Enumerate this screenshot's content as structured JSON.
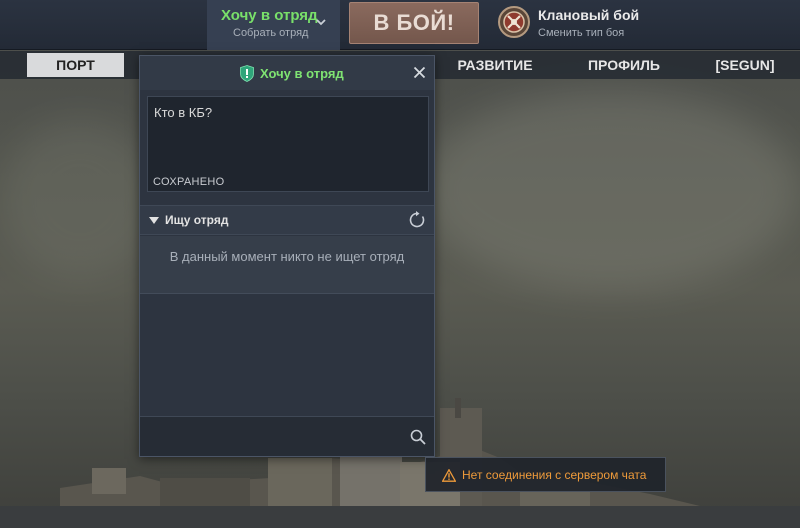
{
  "topbar": {
    "squad": {
      "title": "Хочу в отряд",
      "subtitle": "Собрать отряд",
      "chevron_icon": "chevron-down-icon"
    },
    "battle_button": {
      "label": "В БОЙ!"
    },
    "mode": {
      "icon": "clan-battle-icon",
      "title": "Клановый бой",
      "subtitle": "Сменить тип боя"
    }
  },
  "nav": {
    "items": [
      {
        "label": "ПОРТ",
        "active": true
      },
      {
        "label": "РАЗВИТИЕ"
      },
      {
        "label": "ПРОФИЛЬ"
      },
      {
        "label": "[SEGUN]"
      }
    ]
  },
  "panel": {
    "title": "Хочу в отряд",
    "title_icon": "shield-icon",
    "close_icon": "close-icon",
    "note": {
      "text": "Кто в КБ?",
      "status": "СОХРАНЕНО"
    },
    "search_section": {
      "title": "Ищу отряд",
      "toggle_icon": "triangle-down-icon",
      "refresh_icon": "refresh-icon",
      "empty_message": "В данный момент никто не ищет отряд"
    },
    "footer": {
      "search_icon": "search-icon"
    }
  },
  "toast": {
    "icon": "warning-icon",
    "text": "Нет соединения с сервером чата"
  },
  "colors": {
    "accent_green": "#7fe372",
    "battle_button": "#7d5f54",
    "warning_orange": "#ee9a3a",
    "panel_bg": "#2d3440",
    "topbar_bg": "#2b3341"
  }
}
